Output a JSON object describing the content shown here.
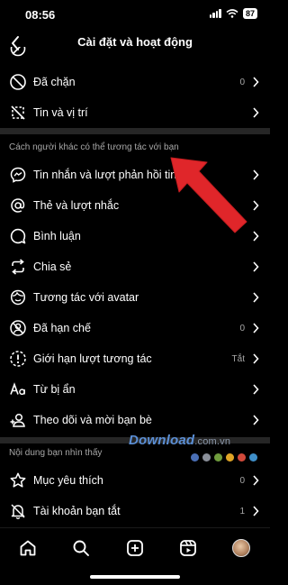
{
  "status": {
    "time": "08:56",
    "battery": "87"
  },
  "header": {
    "title": "Cài đặt và hoạt động"
  },
  "section_top": [
    {
      "label": "Đã chặn",
      "value": "0"
    },
    {
      "label": "Tin và vị trí",
      "value": ""
    }
  ],
  "section_interact": {
    "title": "Cách người khác có thể tương tác với bạn",
    "items": [
      {
        "label": "Tin nhắn và lượt phản hồi tin",
        "value": ""
      },
      {
        "label": "Thẻ và lượt nhắc",
        "value": ""
      },
      {
        "label": "Bình luận",
        "value": ""
      },
      {
        "label": "Chia sẻ",
        "value": ""
      },
      {
        "label": "Tương tác với avatar",
        "value": ""
      },
      {
        "label": "Đã hạn chế",
        "value": "0"
      },
      {
        "label": "Giới hạn lượt tương tác",
        "value": "Tắt"
      },
      {
        "label": "Từ bị ẩn",
        "value": ""
      },
      {
        "label": "Theo dõi và mời bạn bè",
        "value": ""
      }
    ]
  },
  "section_content": {
    "title": "Nội dung bạn nhìn thấy",
    "items": [
      {
        "label": "Mục yêu thích",
        "value": "0"
      },
      {
        "label": "Tài khoản bạn tắt",
        "value": "1"
      }
    ]
  },
  "watermark": {
    "text": "Download",
    "domain": ".com.vn"
  },
  "colors": {
    "background": "#000000",
    "secondary_text": "#a8a8a8",
    "divider": "#262626",
    "arrow": "#e0262a"
  },
  "icons": [
    "chevron-left-icon",
    "block-icon",
    "location-off-icon",
    "messenger-icon",
    "at-icon",
    "comment-icon",
    "share-icon",
    "avatar-face-icon",
    "restricted-icon",
    "limit-icon",
    "hidden-words-icon",
    "add-person-icon",
    "star-icon",
    "mute-bell-icon",
    "home-icon",
    "search-icon",
    "create-icon",
    "reels-icon",
    "profile-avatar"
  ]
}
